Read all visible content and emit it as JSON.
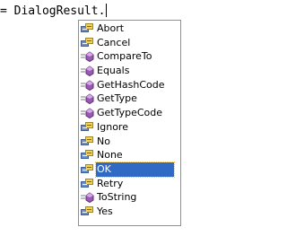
{
  "editor": {
    "code_text": "= DialogResult."
  },
  "completion": {
    "selected": "OK",
    "items": [
      {
        "label": "Abort",
        "icon": "enum-member-icon"
      },
      {
        "label": "Cancel",
        "icon": "enum-member-icon"
      },
      {
        "label": "CompareTo",
        "icon": "method-icon"
      },
      {
        "label": "Equals",
        "icon": "method-icon"
      },
      {
        "label": "GetHashCode",
        "icon": "method-icon"
      },
      {
        "label": "GetType",
        "icon": "method-icon"
      },
      {
        "label": "GetTypeCode",
        "icon": "method-icon"
      },
      {
        "label": "Ignore",
        "icon": "enum-member-icon"
      },
      {
        "label": "No",
        "icon": "enum-member-icon"
      },
      {
        "label": "None",
        "icon": "enum-member-icon"
      },
      {
        "label": "OK",
        "icon": "enum-member-icon"
      },
      {
        "label": "Retry",
        "icon": "enum-member-icon"
      },
      {
        "label": "ToString",
        "icon": "method-icon"
      },
      {
        "label": "Yes",
        "icon": "enum-member-icon"
      }
    ]
  },
  "colors": {
    "selection": "#316ac5",
    "enum_icon_blue": "#6c8ec4",
    "enum_icon_yellow": "#f2d25a",
    "method_icon_purple": "#9b59b6"
  }
}
